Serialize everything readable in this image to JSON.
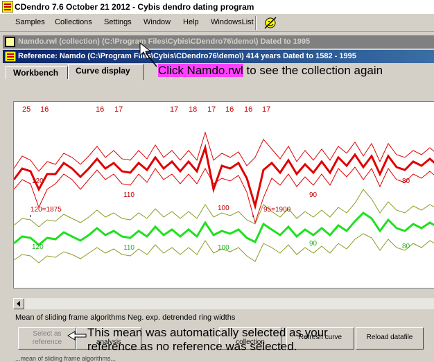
{
  "window": {
    "title": "CDendro 7.6  October 21 2012 - Cybis dendro dating program"
  },
  "menu": [
    "Samples",
    "Collections",
    "Settings",
    "Window",
    "Help",
    "WindowsList"
  ],
  "collection_bar": {
    "text": "Namdo.rwl (collection)  (C:\\Program Files\\Cybis\\CDendro76\\demo\\) Dated to 1995"
  },
  "reference_bar": {
    "text": "Reference: Namdo    (C:\\Program Files\\Cybis\\CDendro76\\demo\\)  414 years  Dated to 1582 - 1995"
  },
  "tabs": [
    "Workbench",
    "Curve display"
  ],
  "callout_top": {
    "highlight": "Click Namdo.rwl",
    "rest": " to see the collection again"
  },
  "plot_labels": {
    "top_counts": [
      "25",
      "16",
      "16",
      "17",
      "17",
      "18",
      "17",
      "16",
      "16",
      "17"
    ],
    "red_labels": [
      "120",
      "110",
      "100",
      "90",
      "80",
      "120=1875",
      "95=1900"
    ],
    "green_labels": [
      "120",
      "110",
      "100",
      "90",
      "80"
    ]
  },
  "colors": {
    "red_line": "#e00000",
    "red_band": "#e00000",
    "green_line": "#20e020",
    "green_band": "#8a9a20",
    "label_red": "#c00000",
    "label_green": "#20b020"
  },
  "status_text": "Mean of sliding frame algorithms  Neg. exp. detrended ring widths",
  "buttons": {
    "select_reference": "Select as\nreference",
    "analysis": "analysis",
    "collection": "collection",
    "refresh_curve": "Refresh curve",
    "reload_datafile": "Reload datafile"
  },
  "callout_bottom": "This mean was automatically selected as your\nreference as no reference was selected.",
  "bottom_text": "...mean of sliding frame algorithms..."
}
